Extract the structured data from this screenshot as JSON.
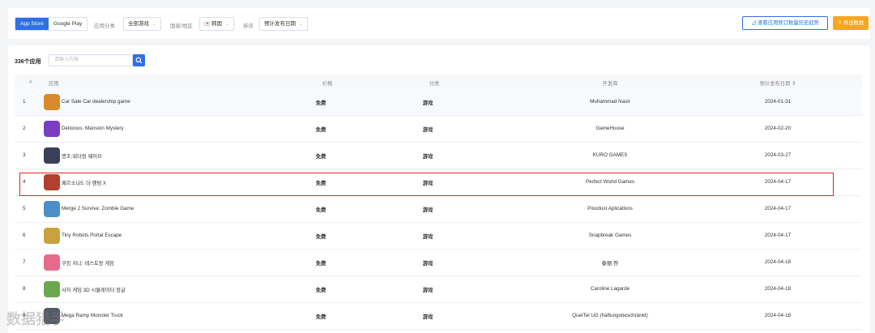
{
  "toolbar": {
    "store_tabs": [
      "App Store",
      "Google Play"
    ],
    "category_label": "应用分类",
    "category_value": "全部游戏",
    "region_label": "国家/地区",
    "region_value": "韩国",
    "sort_label": "排序",
    "sort_value": "预计发布日期",
    "history_button": "查看应用预订数量历史趋势",
    "export_button": "导出数据"
  },
  "table": {
    "count_label": "336个应用",
    "search_placeholder": "请输入内容",
    "columns": [
      "#",
      "应用",
      "价格",
      "分类",
      "开发商",
      "预计发布日期"
    ],
    "rows": [
      {
        "num": "1",
        "name": "Car Sale Car dealership game",
        "price": "免费",
        "category": "游戏",
        "developer": "Muhammad Nasir",
        "date": "2024-01-31"
      },
      {
        "num": "2",
        "name": "Delicious: Mansion Mystery",
        "price": "免费",
        "category": "游戏",
        "developer": "GameHouse",
        "date": "2024-02-20"
      },
      {
        "num": "3",
        "name": "명조:워더링 웨이브",
        "price": "免费",
        "category": "游戏",
        "developer": "KURO GAMES",
        "date": "2024-03-27"
      },
      {
        "num": "4",
        "name": "페르소나5: 더 팬텀 X",
        "price": "免费",
        "category": "游戏",
        "developer": "Perfect World Games",
        "date": "2024-04-17"
      },
      {
        "num": "5",
        "name": "Merge 2 Survive: Zombie Game",
        "price": "免费",
        "category": "游戏",
        "developer": "Pixodust Aplicativos",
        "date": "2024-04-17"
      },
      {
        "num": "6",
        "name": "Tiny Robots Portal Escape",
        "price": "免费",
        "category": "游戏",
        "developer": "Snapbreak Games",
        "date": "2024-04-17"
      },
      {
        "num": "7",
        "name": "쿠킹 저니: 레스토랑 게임",
        "price": "免费",
        "category": "游戏",
        "developer": "泰丽 乔",
        "date": "2024-04-18"
      },
      {
        "num": "8",
        "name": "사자 게임 3D 시뮬레이터 정글",
        "price": "免费",
        "category": "游戏",
        "developer": "Caroline Lagarde",
        "date": "2024-04-18"
      },
      {
        "num": "9",
        "name": "Mega Ramp Monster Truck",
        "price": "免费",
        "category": "游戏",
        "developer": "QuelTel UG (haftungsbeschränkt)",
        "date": "2024-04-18"
      }
    ]
  },
  "watermark": "数据猎手",
  "icon_colors": [
    "#d98b2b",
    "#7a3ec4",
    "#3a3f5a",
    "#b3402f",
    "#4a8fc9",
    "#c9a23e",
    "#e86a8a",
    "#6aa84f",
    "#555a66"
  ]
}
